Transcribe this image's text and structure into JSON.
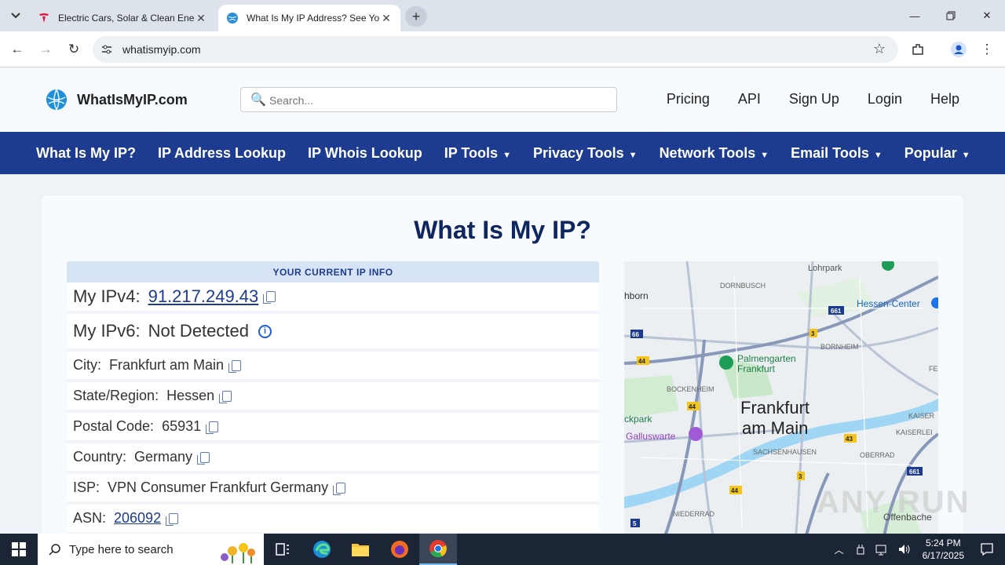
{
  "browser": {
    "tabs": [
      {
        "title": "Electric Cars, Solar & Clean Energy | Tesla",
        "active": false
      },
      {
        "title": "What Is My IP Address? See Your Public Address",
        "active": true
      }
    ],
    "url": "whatismyip.com"
  },
  "site": {
    "logo_text": "WhatIsMyIP.com",
    "search_placeholder": "Search...",
    "top_links": [
      "Pricing",
      "API",
      "Sign Up",
      "Login",
      "Help"
    ],
    "nav": [
      {
        "label": "What Is My IP?",
        "dropdown": false
      },
      {
        "label": "IP Address Lookup",
        "dropdown": false
      },
      {
        "label": "IP Whois Lookup",
        "dropdown": false
      },
      {
        "label": "IP Tools",
        "dropdown": true
      },
      {
        "label": "Privacy Tools",
        "dropdown": true
      },
      {
        "label": "Network Tools",
        "dropdown": true
      },
      {
        "label": "Email Tools",
        "dropdown": true
      },
      {
        "label": "Popular",
        "dropdown": true
      }
    ],
    "caret": "▼"
  },
  "page": {
    "title": "What Is My IP?",
    "info_header": "YOUR CURRENT IP INFO",
    "ipv4_label": "My IPv4:",
    "ipv4": "91.217.249.43",
    "ipv6_label": "My IPv6:",
    "ipv6": "Not Detected",
    "details": [
      {
        "label": "City:",
        "value": "Frankfurt am Main",
        "link": false
      },
      {
        "label": "State/Region:",
        "value": "Hessen",
        "link": false
      },
      {
        "label": "Postal Code:",
        "value": "65931",
        "link": false
      },
      {
        "label": "Country:",
        "value": "Germany",
        "link": false
      },
      {
        "label": "ISP:",
        "value": "VPN Consumer Frankfurt Germany",
        "link": false
      },
      {
        "label": "ASN:",
        "value": "206092",
        "link": true
      }
    ]
  },
  "map": {
    "city_line1": "Frankfurt",
    "city_line2": "am Main",
    "labels": [
      "Lohrpark",
      "DORNBUSCH",
      "Hessen-Center",
      "hborn",
      "BORNHEIM",
      "Palmengarten",
      "Frankfurt",
      "BOCKENHEIM",
      "ckpark",
      "Galluswarte",
      "KAISER",
      "KAISERLEI",
      "SACHSENHAUSEN",
      "OBERRAD",
      "NIEDERRAD",
      "Offenbache",
      "FE"
    ],
    "road_labels": [
      "661",
      "3",
      "66",
      "44",
      "44",
      "43",
      "661",
      "3",
      "44",
      "5"
    ]
  },
  "watermark": "ANY RUN",
  "taskbar": {
    "search_placeholder": "Type here to search",
    "time": "5:24 PM",
    "date": "6/17/2025"
  },
  "colors": {
    "nav_bg": "#1d3b8f",
    "title": "#10265e",
    "link": "#1d3b8f"
  }
}
